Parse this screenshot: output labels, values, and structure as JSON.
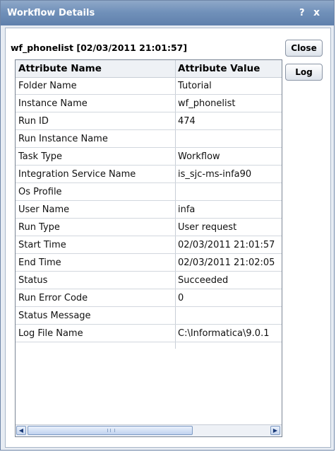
{
  "window": {
    "title": "Workflow Details",
    "help_glyph": "?",
    "close_glyph": "x"
  },
  "heading": "wf_phonelist [02/03/2011 21:01:57]",
  "buttons": {
    "close": "Close",
    "log": "Log"
  },
  "table": {
    "columns": [
      "Attribute Name",
      "Attribute Value"
    ],
    "rows": [
      {
        "name": "Folder Name",
        "value": "Tutorial"
      },
      {
        "name": "Instance Name",
        "value": "wf_phonelist"
      },
      {
        "name": "Run ID",
        "value": "474"
      },
      {
        "name": "Run Instance Name",
        "value": ""
      },
      {
        "name": "Task Type",
        "value": "Workflow"
      },
      {
        "name": "Integration Service Name",
        "value": "is_sjc-ms-infa90"
      },
      {
        "name": "Os Profile",
        "value": ""
      },
      {
        "name": "User Name",
        "value": "infa"
      },
      {
        "name": "Run Type",
        "value": "User request"
      },
      {
        "name": "Start Time",
        "value": "02/03/2011 21:01:57"
      },
      {
        "name": "End Time",
        "value": "02/03/2011 21:02:05"
      },
      {
        "name": "Status",
        "value": "Succeeded"
      },
      {
        "name": "Run Error Code",
        "value": "0"
      },
      {
        "name": "Status Message",
        "value": ""
      },
      {
        "name": "Log File Name",
        "value": "C:\\Informatica\\9.0.1"
      }
    ]
  },
  "scrollbar": {
    "left_icon": "arrow-left-icon",
    "right_icon": "arrow-right-icon"
  },
  "colors": {
    "titlebar": "#7191ba",
    "dialog_bg": "#e7ecf3",
    "grid_border": "#7b8695"
  }
}
